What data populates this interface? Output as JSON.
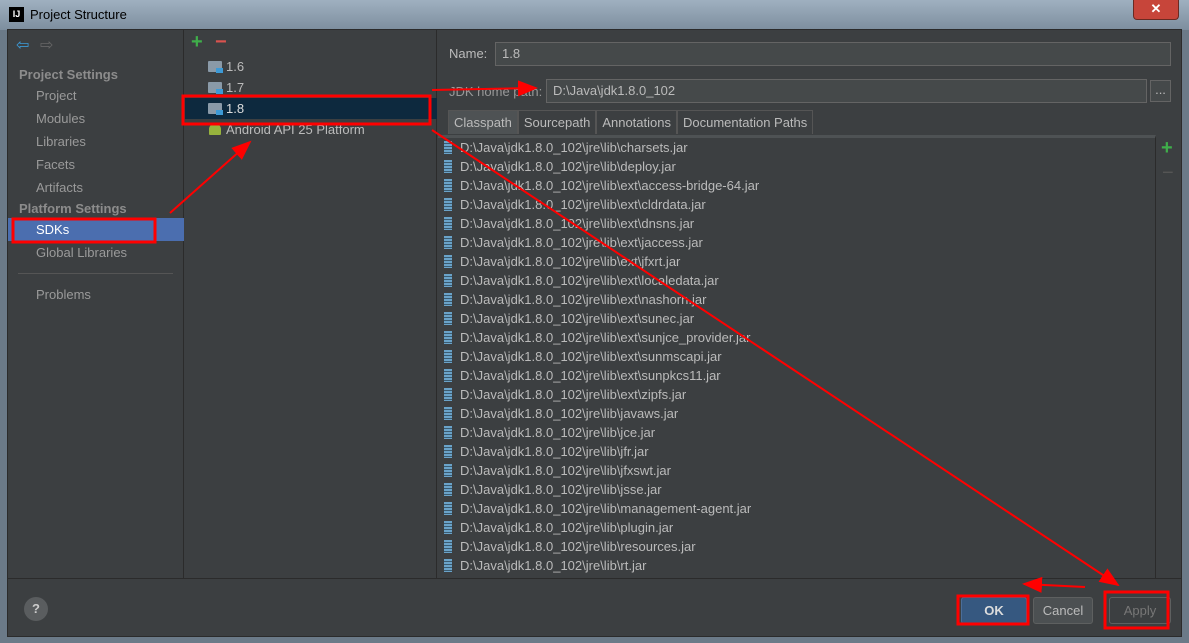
{
  "window": {
    "title": "Project Structure",
    "app_icon": "IJ",
    "close": "✕"
  },
  "sidebar": {
    "project_settings": "Project Settings",
    "platform_settings": "Platform Settings",
    "items": [
      "Project",
      "Modules",
      "Libraries",
      "Facets",
      "Artifacts"
    ],
    "platform_items": [
      "SDKs",
      "Global Libraries"
    ],
    "problems": "Problems",
    "selected": "SDKs"
  },
  "sdks": {
    "add": "+",
    "remove": "−",
    "items": [
      "1.6",
      "1.7",
      "1.8",
      "Android API 25 Platform"
    ],
    "selected": "1.8"
  },
  "detail": {
    "name_label": "Name:",
    "name_value": "1.8",
    "home_label": "JDK home path:",
    "home_value": "D:\\Java\\jdk1.8.0_102",
    "browse": "...",
    "tabs": [
      "Classpath",
      "Sourcepath",
      "Annotations",
      "Documentation Paths"
    ],
    "active_tab": "Classpath",
    "classpath": [
      "D:\\Java\\jdk1.8.0_102\\jre\\lib\\charsets.jar",
      "D:\\Java\\jdk1.8.0_102\\jre\\lib\\deploy.jar",
      "D:\\Java\\jdk1.8.0_102\\jre\\lib\\ext\\access-bridge-64.jar",
      "D:\\Java\\jdk1.8.0_102\\jre\\lib\\ext\\cldrdata.jar",
      "D:\\Java\\jdk1.8.0_102\\jre\\lib\\ext\\dnsns.jar",
      "D:\\Java\\jdk1.8.0_102\\jre\\lib\\ext\\jaccess.jar",
      "D:\\Java\\jdk1.8.0_102\\jre\\lib\\ext\\jfxrt.jar",
      "D:\\Java\\jdk1.8.0_102\\jre\\lib\\ext\\localedata.jar",
      "D:\\Java\\jdk1.8.0_102\\jre\\lib\\ext\\nashorn.jar",
      "D:\\Java\\jdk1.8.0_102\\jre\\lib\\ext\\sunec.jar",
      "D:\\Java\\jdk1.8.0_102\\jre\\lib\\ext\\sunjce_provider.jar",
      "D:\\Java\\jdk1.8.0_102\\jre\\lib\\ext\\sunmscapi.jar",
      "D:\\Java\\jdk1.8.0_102\\jre\\lib\\ext\\sunpkcs11.jar",
      "D:\\Java\\jdk1.8.0_102\\jre\\lib\\ext\\zipfs.jar",
      "D:\\Java\\jdk1.8.0_102\\jre\\lib\\javaws.jar",
      "D:\\Java\\jdk1.8.0_102\\jre\\lib\\jce.jar",
      "D:\\Java\\jdk1.8.0_102\\jre\\lib\\jfr.jar",
      "D:\\Java\\jdk1.8.0_102\\jre\\lib\\jfxswt.jar",
      "D:\\Java\\jdk1.8.0_102\\jre\\lib\\jsse.jar",
      "D:\\Java\\jdk1.8.0_102\\jre\\lib\\management-agent.jar",
      "D:\\Java\\jdk1.8.0_102\\jre\\lib\\plugin.jar",
      "D:\\Java\\jdk1.8.0_102\\jre\\lib\\resources.jar",
      "D:\\Java\\jdk1.8.0_102\\jre\\lib\\rt.jar"
    ],
    "add": "+",
    "remove": "−"
  },
  "footer": {
    "help": "?",
    "ok": "OK",
    "cancel": "Cancel",
    "apply": "Apply"
  },
  "colors": {
    "selection": "#4b6eaf",
    "annotation": "#ff0000"
  }
}
